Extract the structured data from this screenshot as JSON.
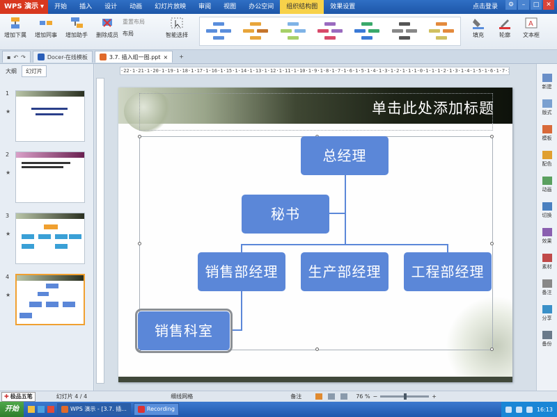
{
  "app": {
    "logo_label": "WPS 演示"
  },
  "menu": {
    "tabs": [
      "开始",
      "插入",
      "设计",
      "动画",
      "幻灯片放映",
      "审阅",
      "视图",
      "办公空间",
      "组织结构图",
      "效果设置"
    ],
    "active_tab": "组织结构图",
    "right_item": "点击登录"
  },
  "ribbon": {
    "add_below": "增加下属",
    "add_peer": "增加同事",
    "add_assistant": "增加助手",
    "delete_member": "删除成员",
    "reset_layout": "重置布局",
    "layout": "布局",
    "smart_select": "智能选择",
    "fill": "填充",
    "outline": "轮廓",
    "text_frame": "文本框"
  },
  "doc_tabs": {
    "template_tab": "Docer-在线模板",
    "file_tab": "3.7. 插入组一图.ppt"
  },
  "left_panel": {
    "tab_outline": "大纲",
    "tab_slides": "幻灯片",
    "slides": [
      {
        "number": "1",
        "star": "★"
      },
      {
        "number": "2",
        "star": "★"
      },
      {
        "number": "3",
        "star": "★"
      },
      {
        "number": "4",
        "star": "★"
      }
    ]
  },
  "ruler": {
    "text": "·22·1·21·1·20·1·19·1·18·1·17·1·16·1·15·1·14·1·13·1·12·1·11·1·10·1·9·1·8·1·7·1·6·1·5·1·4·1·3·1·2·1·1·1·0·1·1·1·2·1·3·1·4·1·5·1·6·1·7·1·8·1·9·1·10·1·11·1·12·1·13·1·14·1·15·1·16·1·17·1·18·1·19·1·20·1·21·1·22·1·23·1·"
  },
  "slide": {
    "title": "单击此处添加标题",
    "org": {
      "ceo": "总经理",
      "secretary": "秘书",
      "sales_manager": "销售部经理",
      "production_manager": "生产部经理",
      "engineering_manager": "工程部经理",
      "sales_section": "销售科室"
    }
  },
  "right_toolbar": [
    "新建",
    "版式",
    "模板",
    "配色",
    "动画",
    "切换",
    "效果",
    "素材",
    "备注",
    "分享",
    "备份"
  ],
  "status": {
    "ime": "极品五笔",
    "slide_counter": "幻灯片 4 / 4",
    "theme": "细线网格",
    "notes": "备注",
    "zoom": "76 %"
  },
  "taskbar": {
    "start": "开始",
    "task_wps": "WPS 演示 - [3.7. 插...",
    "task_rec": "Recording",
    "time": "16:13"
  },
  "colors": {
    "node": "#5b87d8",
    "menu_bar": "#2f6fc4",
    "active_tab": "#f7d24a"
  }
}
